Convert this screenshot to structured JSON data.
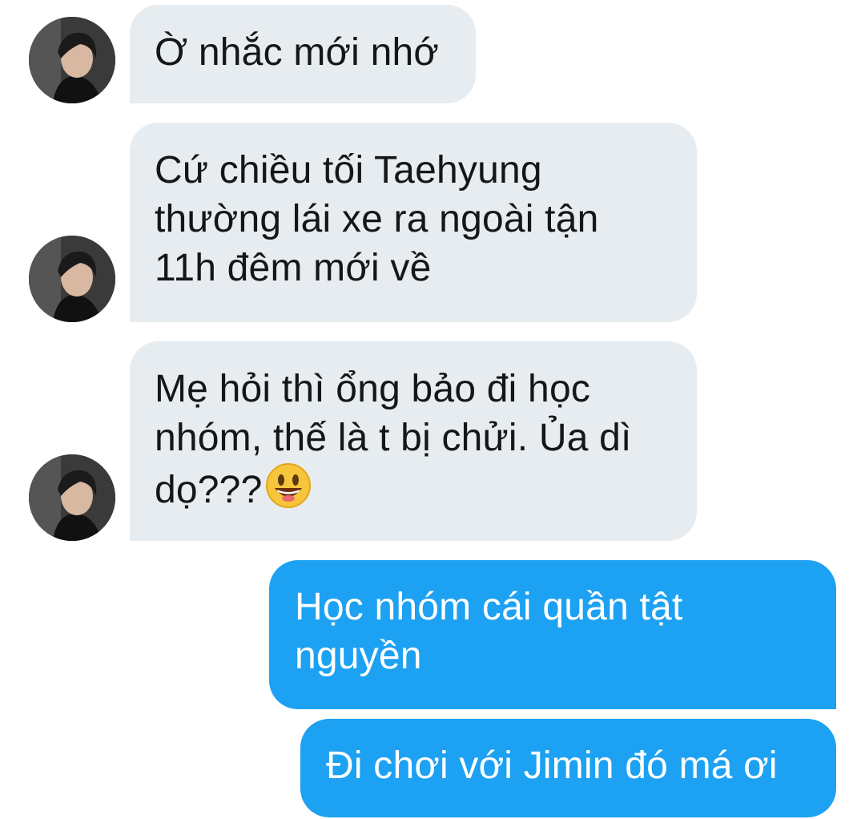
{
  "conversation": {
    "messages": [
      {
        "direction": "incoming",
        "lines": [
          "Ờ nhắc mới nhớ"
        ]
      },
      {
        "direction": "incoming",
        "lines": [
          "Cứ chiều tối Taehyung",
          "thường lái xe ra ngoài tận",
          "11h đêm mới về"
        ]
      },
      {
        "direction": "incoming",
        "lines": [
          "Mẹ hỏi thì ổng bảo đi học",
          "nhóm, thế là t bị chửi. Ủa dì",
          "dọ???"
        ],
        "emoji": "grinning-face-emoji"
      },
      {
        "direction": "outgoing",
        "lines": [
          "Học nhóm cái quần tật",
          "nguyền"
        ]
      },
      {
        "direction": "outgoing",
        "lines": [
          "Đi chơi với Jimin đó má ơi"
        ]
      }
    ]
  },
  "colors": {
    "incoming_bubble": "#e6ecf0",
    "outgoing_bubble": "#1da1f2",
    "incoming_text": "#14171a",
    "outgoing_text": "#ffffff"
  },
  "icons": {
    "avatar": "contact-avatar-photo",
    "emoji": "grinning-face-emoji"
  }
}
